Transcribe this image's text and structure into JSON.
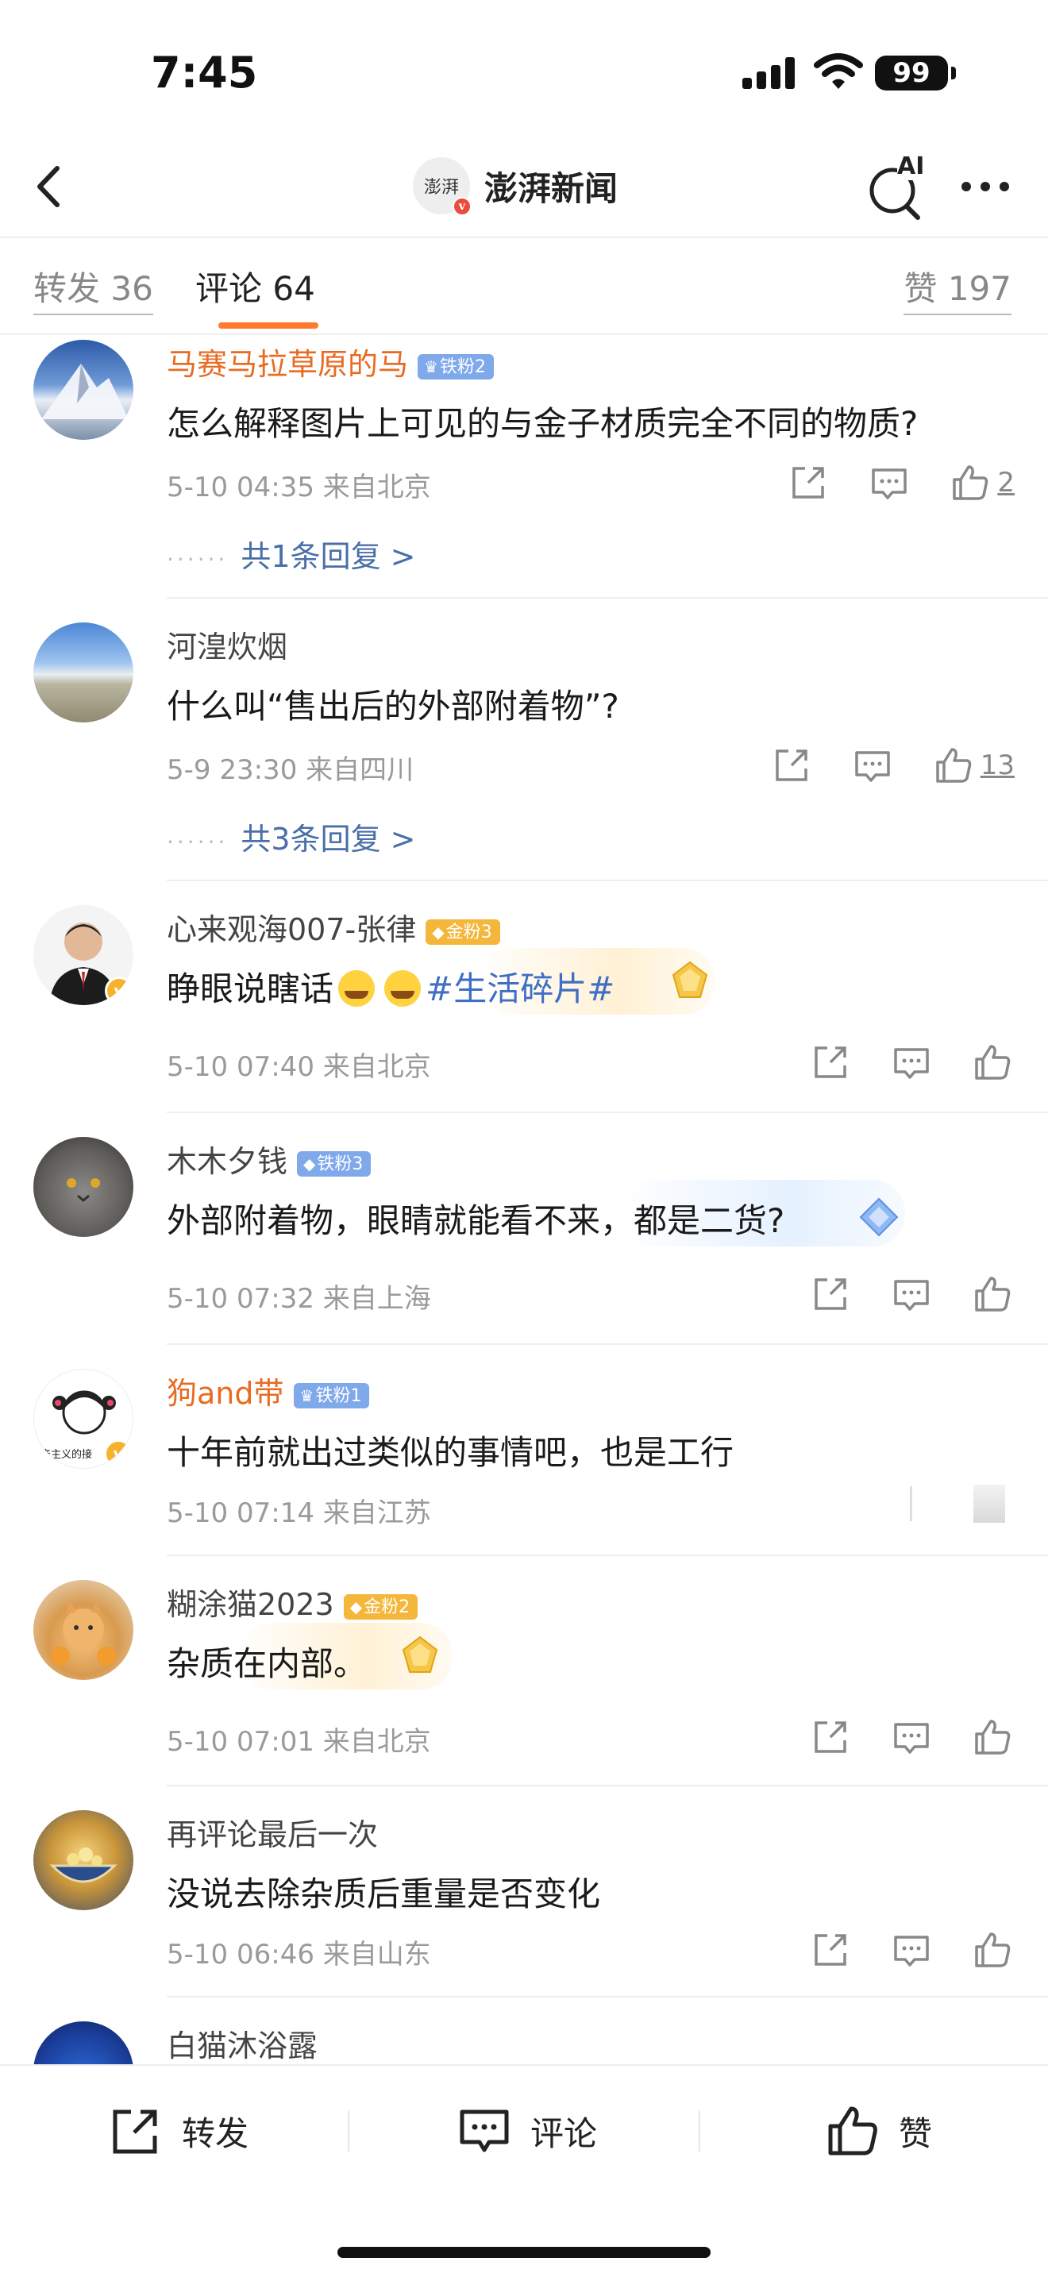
{
  "status": {
    "time": "7:45",
    "battery": "99"
  },
  "nav": {
    "logo_text": "澎湃",
    "title": "澎湃新闻",
    "ai_label": "AI"
  },
  "tabs": {
    "forward": "转发 36",
    "comments": "评论 64",
    "likes": "赞 197"
  },
  "comments": [
    {
      "name": "马赛马拉草原的马",
      "badge": "铁粉2",
      "text": "怎么解释图片上可见的与金子材质完全不同的物质?",
      "meta": "5-10 04:35 来自北京",
      "likes": "2",
      "replies": "共1条回复 >"
    },
    {
      "name": "河湟炊烟",
      "text": "什么叫“售出后的外部附着物”?",
      "meta": "5-9 23:30 来自四川",
      "likes": "13",
      "replies": "共3条回复 >"
    },
    {
      "name": "心来观海007-张律",
      "badge": "金粉3",
      "text": "睁眼说瞎话",
      "topic": "#生活碎片#",
      "meta": "5-10 07:40 来自北京"
    },
    {
      "name": "木木夕钱",
      "badge": "铁粉3",
      "text": "外部附着物，眼睛就能看不来，都是二货?",
      "meta": "5-10 07:32 来自上海"
    },
    {
      "name": "狗and带",
      "badge": "铁粉1",
      "avatar_text": "产主义的接",
      "text": "十年前就出过类似的事情吧，也是工行",
      "meta": "5-10 07:14 来自江苏"
    },
    {
      "name": "糊涂猫2023",
      "badge": "金粉2",
      "text": "杂质在内部。",
      "meta": "5-10 07:01 来自北京"
    },
    {
      "name": "再评论最后一次",
      "text": "没说去除杂质后重量是否变化",
      "meta": "5-10 06:46 来自山东"
    },
    {
      "name": "白猫沐浴露"
    }
  ],
  "bottom": {
    "forward": "转发",
    "comment": "评论",
    "like": "赞"
  },
  "colors": {
    "accent": "#ff7a2f",
    "link": "#4a6fa8",
    "orange_name": "#e86b22"
  }
}
